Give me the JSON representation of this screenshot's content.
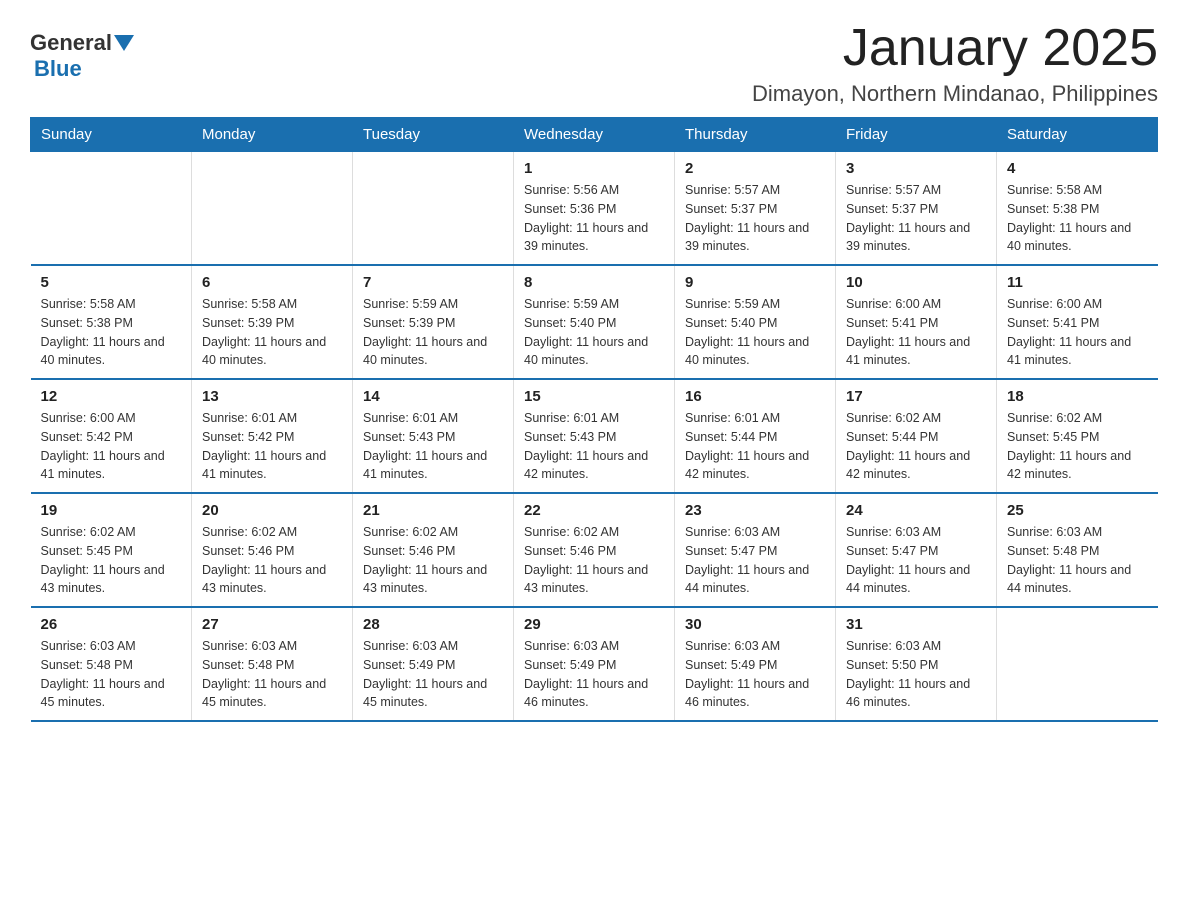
{
  "header": {
    "logo_general": "General",
    "logo_blue": "Blue",
    "month_title": "January 2025",
    "location": "Dimayon, Northern Mindanao, Philippines"
  },
  "days_of_week": [
    "Sunday",
    "Monday",
    "Tuesday",
    "Wednesday",
    "Thursday",
    "Friday",
    "Saturday"
  ],
  "weeks": [
    [
      {
        "day": "",
        "sunrise": "",
        "sunset": "",
        "daylight": ""
      },
      {
        "day": "",
        "sunrise": "",
        "sunset": "",
        "daylight": ""
      },
      {
        "day": "",
        "sunrise": "",
        "sunset": "",
        "daylight": ""
      },
      {
        "day": "1",
        "sunrise": "Sunrise: 5:56 AM",
        "sunset": "Sunset: 5:36 PM",
        "daylight": "Daylight: 11 hours and 39 minutes."
      },
      {
        "day": "2",
        "sunrise": "Sunrise: 5:57 AM",
        "sunset": "Sunset: 5:37 PM",
        "daylight": "Daylight: 11 hours and 39 minutes."
      },
      {
        "day": "3",
        "sunrise": "Sunrise: 5:57 AM",
        "sunset": "Sunset: 5:37 PM",
        "daylight": "Daylight: 11 hours and 39 minutes."
      },
      {
        "day": "4",
        "sunrise": "Sunrise: 5:58 AM",
        "sunset": "Sunset: 5:38 PM",
        "daylight": "Daylight: 11 hours and 40 minutes."
      }
    ],
    [
      {
        "day": "5",
        "sunrise": "Sunrise: 5:58 AM",
        "sunset": "Sunset: 5:38 PM",
        "daylight": "Daylight: 11 hours and 40 minutes."
      },
      {
        "day": "6",
        "sunrise": "Sunrise: 5:58 AM",
        "sunset": "Sunset: 5:39 PM",
        "daylight": "Daylight: 11 hours and 40 minutes."
      },
      {
        "day": "7",
        "sunrise": "Sunrise: 5:59 AM",
        "sunset": "Sunset: 5:39 PM",
        "daylight": "Daylight: 11 hours and 40 minutes."
      },
      {
        "day": "8",
        "sunrise": "Sunrise: 5:59 AM",
        "sunset": "Sunset: 5:40 PM",
        "daylight": "Daylight: 11 hours and 40 minutes."
      },
      {
        "day": "9",
        "sunrise": "Sunrise: 5:59 AM",
        "sunset": "Sunset: 5:40 PM",
        "daylight": "Daylight: 11 hours and 40 minutes."
      },
      {
        "day": "10",
        "sunrise": "Sunrise: 6:00 AM",
        "sunset": "Sunset: 5:41 PM",
        "daylight": "Daylight: 11 hours and 41 minutes."
      },
      {
        "day": "11",
        "sunrise": "Sunrise: 6:00 AM",
        "sunset": "Sunset: 5:41 PM",
        "daylight": "Daylight: 11 hours and 41 minutes."
      }
    ],
    [
      {
        "day": "12",
        "sunrise": "Sunrise: 6:00 AM",
        "sunset": "Sunset: 5:42 PM",
        "daylight": "Daylight: 11 hours and 41 minutes."
      },
      {
        "day": "13",
        "sunrise": "Sunrise: 6:01 AM",
        "sunset": "Sunset: 5:42 PM",
        "daylight": "Daylight: 11 hours and 41 minutes."
      },
      {
        "day": "14",
        "sunrise": "Sunrise: 6:01 AM",
        "sunset": "Sunset: 5:43 PM",
        "daylight": "Daylight: 11 hours and 41 minutes."
      },
      {
        "day": "15",
        "sunrise": "Sunrise: 6:01 AM",
        "sunset": "Sunset: 5:43 PM",
        "daylight": "Daylight: 11 hours and 42 minutes."
      },
      {
        "day": "16",
        "sunrise": "Sunrise: 6:01 AM",
        "sunset": "Sunset: 5:44 PM",
        "daylight": "Daylight: 11 hours and 42 minutes."
      },
      {
        "day": "17",
        "sunrise": "Sunrise: 6:02 AM",
        "sunset": "Sunset: 5:44 PM",
        "daylight": "Daylight: 11 hours and 42 minutes."
      },
      {
        "day": "18",
        "sunrise": "Sunrise: 6:02 AM",
        "sunset": "Sunset: 5:45 PM",
        "daylight": "Daylight: 11 hours and 42 minutes."
      }
    ],
    [
      {
        "day": "19",
        "sunrise": "Sunrise: 6:02 AM",
        "sunset": "Sunset: 5:45 PM",
        "daylight": "Daylight: 11 hours and 43 minutes."
      },
      {
        "day": "20",
        "sunrise": "Sunrise: 6:02 AM",
        "sunset": "Sunset: 5:46 PM",
        "daylight": "Daylight: 11 hours and 43 minutes."
      },
      {
        "day": "21",
        "sunrise": "Sunrise: 6:02 AM",
        "sunset": "Sunset: 5:46 PM",
        "daylight": "Daylight: 11 hours and 43 minutes."
      },
      {
        "day": "22",
        "sunrise": "Sunrise: 6:02 AM",
        "sunset": "Sunset: 5:46 PM",
        "daylight": "Daylight: 11 hours and 43 minutes."
      },
      {
        "day": "23",
        "sunrise": "Sunrise: 6:03 AM",
        "sunset": "Sunset: 5:47 PM",
        "daylight": "Daylight: 11 hours and 44 minutes."
      },
      {
        "day": "24",
        "sunrise": "Sunrise: 6:03 AM",
        "sunset": "Sunset: 5:47 PM",
        "daylight": "Daylight: 11 hours and 44 minutes."
      },
      {
        "day": "25",
        "sunrise": "Sunrise: 6:03 AM",
        "sunset": "Sunset: 5:48 PM",
        "daylight": "Daylight: 11 hours and 44 minutes."
      }
    ],
    [
      {
        "day": "26",
        "sunrise": "Sunrise: 6:03 AM",
        "sunset": "Sunset: 5:48 PM",
        "daylight": "Daylight: 11 hours and 45 minutes."
      },
      {
        "day": "27",
        "sunrise": "Sunrise: 6:03 AM",
        "sunset": "Sunset: 5:48 PM",
        "daylight": "Daylight: 11 hours and 45 minutes."
      },
      {
        "day": "28",
        "sunrise": "Sunrise: 6:03 AM",
        "sunset": "Sunset: 5:49 PM",
        "daylight": "Daylight: 11 hours and 45 minutes."
      },
      {
        "day": "29",
        "sunrise": "Sunrise: 6:03 AM",
        "sunset": "Sunset: 5:49 PM",
        "daylight": "Daylight: 11 hours and 46 minutes."
      },
      {
        "day": "30",
        "sunrise": "Sunrise: 6:03 AM",
        "sunset": "Sunset: 5:49 PM",
        "daylight": "Daylight: 11 hours and 46 minutes."
      },
      {
        "day": "31",
        "sunrise": "Sunrise: 6:03 AM",
        "sunset": "Sunset: 5:50 PM",
        "daylight": "Daylight: 11 hours and 46 minutes."
      },
      {
        "day": "",
        "sunrise": "",
        "sunset": "",
        "daylight": ""
      }
    ]
  ]
}
